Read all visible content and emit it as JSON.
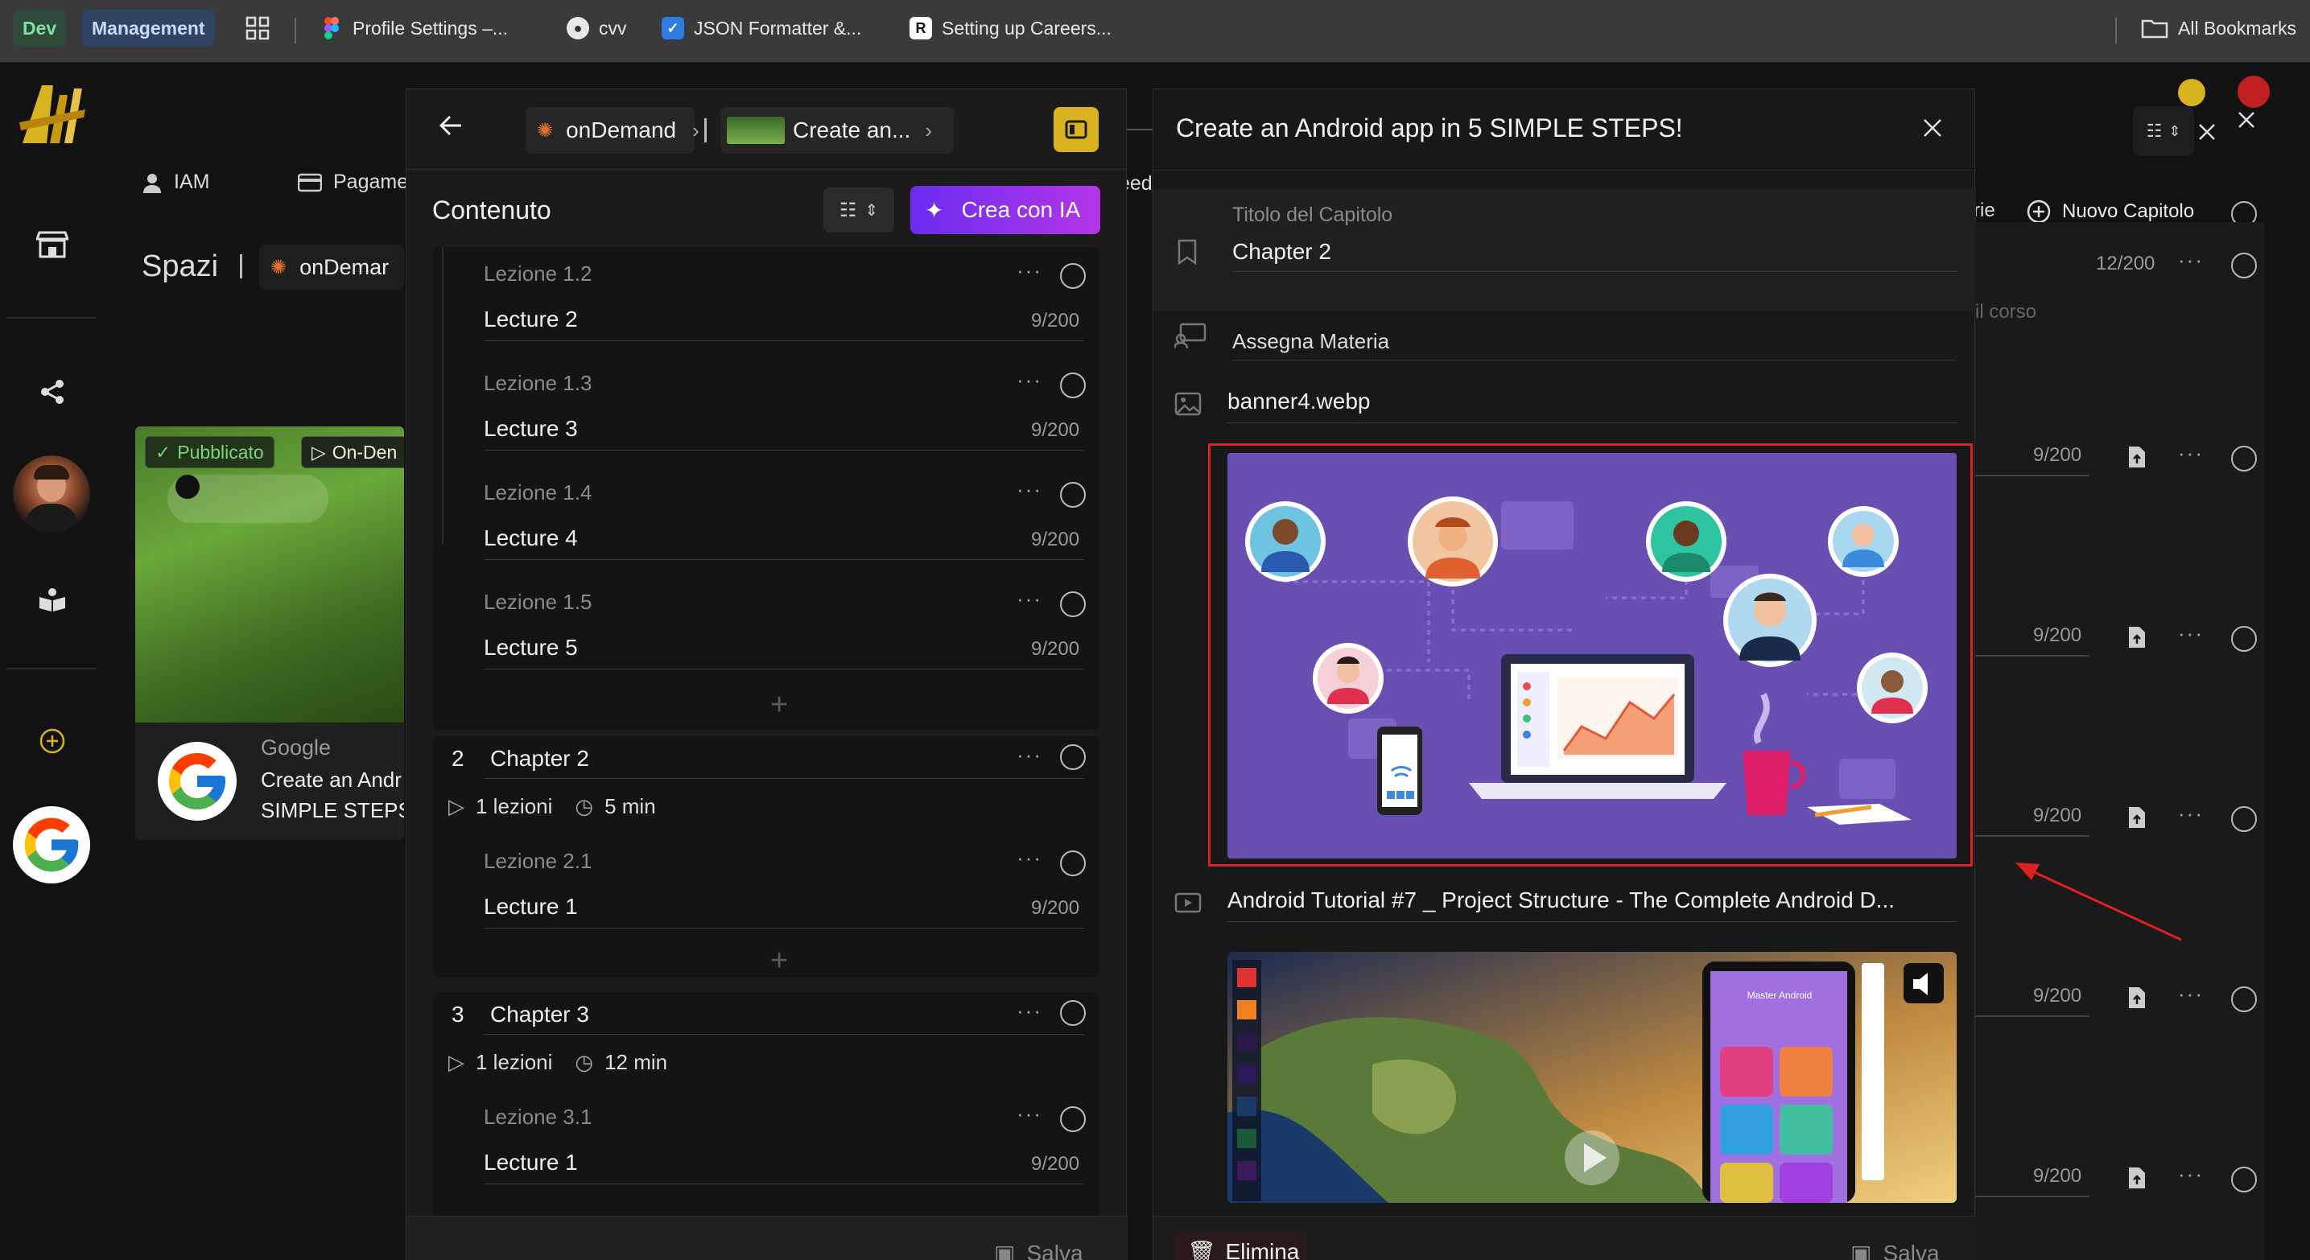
{
  "bookmarks": {
    "dev": "Dev",
    "management": "Management",
    "items": [
      {
        "label": "Profile Settings –...",
        "icon": "figma-icon"
      },
      {
        "label": "cvv",
        "icon": "github-icon"
      },
      {
        "label": "JSON Formatter &...",
        "icon": "checkbox-icon"
      },
      {
        "label": "Setting up Careers...",
        "icon": "r-logo-icon"
      }
    ],
    "all_bookmarks": "All Bookmarks"
  },
  "background": {
    "tab_iam": "IAM",
    "tab_pagamenti": "Pagame",
    "tab_feedback": "eed",
    "spazi_title": "Spazi",
    "spazi_breadcrumb": "onDemar",
    "badge_published": "Pubblicato",
    "badge_ondemand": "On-Den",
    "card_brand": "Google",
    "card_title_1": "Create an Andr",
    "card_title_2": "SIMPLE STEPS",
    "right_tab_partial": "rie",
    "new_chapter": "Nuovo Capitolo",
    "right_counter_top": "12/200",
    "right_hint": "il corso",
    "right_counters": [
      "9/200",
      "9/200",
      "9/200",
      "9/200",
      "9/200"
    ]
  },
  "middle_panel": {
    "breadcrumb_space": "onDemand",
    "breadcrumb_course": "Create an...",
    "section_title": "Contenuto",
    "ai_button": "Crea con IA",
    "chapter1_lessons": [
      {
        "label": "Lezione 1.2",
        "title": "Lecture 2",
        "counter": "9/200"
      },
      {
        "label": "Lezione 1.3",
        "title": "Lecture 3",
        "counter": "9/200"
      },
      {
        "label": "Lezione 1.4",
        "title": "Lecture 4",
        "counter": "9/200"
      },
      {
        "label": "Lezione 1.5",
        "title": "Lecture 5",
        "counter": "9/200"
      }
    ],
    "chapter2": {
      "number": "2",
      "title": "Chapter 2",
      "lessons_count": "1 lezioni",
      "duration": "5 min",
      "lesson": {
        "label": "Lezione 2.1",
        "title": "Lecture 1",
        "counter": "9/200"
      }
    },
    "chapter3": {
      "number": "3",
      "title": "Chapter 3",
      "lessons_count": "1 lezioni",
      "duration": "12 min",
      "lesson": {
        "label": "Lezione 3.1",
        "title": "Lecture 1",
        "counter": "9/200"
      }
    },
    "save": "Salva"
  },
  "right_panel": {
    "title": "Create an Android app in 5 SIMPLE STEPS!",
    "chapter_title_label": "Titolo del Capitolo",
    "chapter_title_value": "Chapter 2",
    "assign_subject": "Assegna Materia",
    "banner_filename": "banner4.webp",
    "video_title": "Android Tutorial #7 _ Project Structure - The Complete Android D...",
    "video_screen_title": "Master Android",
    "delete": "Elimina",
    "save": "Salva"
  },
  "colors": {
    "accent_yellow": "#d9b21f",
    "ai_gradient_start": "#6a2cf0",
    "ai_gradient_end": "#b535e8",
    "highlight_red": "#e02020",
    "banner_purple": "#6a4fb3",
    "published_green": "#4caf50"
  }
}
